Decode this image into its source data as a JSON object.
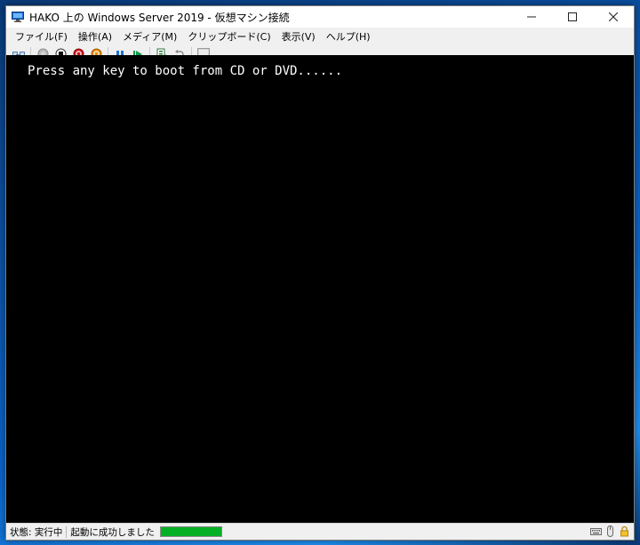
{
  "window": {
    "title": "HAKO 上の Windows Server 2019 - 仮想マシン接続",
    "minimize_icon": "minimize-icon",
    "maximize_icon": "maximize-icon",
    "close_icon": "close-icon"
  },
  "menu": {
    "items": [
      "ファイル(F)",
      "操作(A)",
      "メディア(M)",
      "クリップボード(C)",
      "表示(V)",
      "ヘルプ(H)"
    ]
  },
  "toolbar": {
    "icons": [
      "ctrl-alt-del-icon",
      "start-icon",
      "turn-off-icon",
      "shutdown-icon",
      "save-icon",
      "pause-icon",
      "resume-icon",
      "checkpoint-icon",
      "revert-icon",
      "enhanced-session-icon"
    ]
  },
  "console": {
    "text": "Press any key to boot from CD or DVD......",
    "background": "#000000",
    "text_color": "#ffffff"
  },
  "status": {
    "state": "状態: 実行中",
    "message": "起動に成功しました",
    "progress": 1.0,
    "progress_color": "#06b025",
    "icons": [
      "keyboard-icon",
      "mouse-icon",
      "lock-icon"
    ]
  }
}
